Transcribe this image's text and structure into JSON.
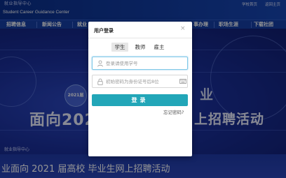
{
  "header": {
    "logo_cn": "就业指导中心",
    "logo_en": "Student Career Guidance Center",
    "links": [
      "学校首页",
      "返回主页"
    ]
  },
  "nav": {
    "items": [
      "招聘信息",
      "新闻公告",
      "就业",
      "事办理",
      "职场生涯",
      "下载社团"
    ]
  },
  "hero": {
    "badge": "2021届",
    "title_left": "面向2021",
    "title_right": "上招聘活动",
    "word_right": "业"
  },
  "bottom": {
    "small_text": "就业指导中心",
    "title": "业面向 2021 届高校 毕业生网上招聘活动"
  },
  "modal": {
    "title": "用户登录",
    "close_symbol": "×",
    "tabs": [
      "学生",
      "教师",
      "雇主"
    ],
    "active_tab": "学生",
    "username_placeholder": "登录请使用学号",
    "password_placeholder": "初始密码为身份证号后8位",
    "login_label": "登录",
    "forgot_label": "忘记密码?"
  },
  "colors": {
    "accent": "#22a6b8",
    "nav_bg": "#163fa6",
    "focus_border": "#7fc8e8"
  },
  "icons": [
    "user-icon",
    "lock-icon",
    "keyboard-icon",
    "close-icon"
  ]
}
